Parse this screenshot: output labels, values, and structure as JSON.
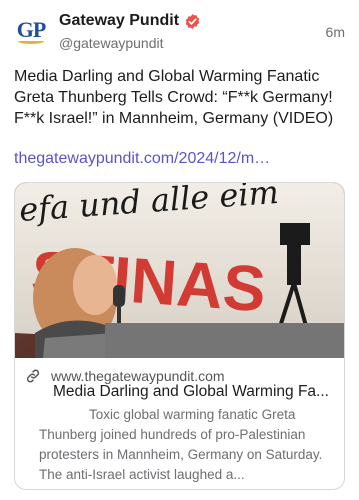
{
  "author": {
    "name": "Gateway Pundit",
    "handle": "@gatewaypundit",
    "avatar_text": "GP",
    "verified": true
  },
  "post": {
    "time": "6m",
    "text": "Media Darling and Global Warming Fanatic Greta Thunberg Tells Crowd: “F**k Germany! F**k Israel!” in Mannheim, Germany (VIDEO)",
    "link": "thegatewaypundit.com/2024/12/m…"
  },
  "card": {
    "domain": "www.thegatewaypundit.com",
    "title": "Media Darling and Global Warming Fa...",
    "description": "Toxic global warming fanatic Greta Thunberg joined hundreds of pro-Palestinian protesters in Mannheim, Germany on Saturday.  The anti-Israel activist laughed a...",
    "banner_text_top": "efa und alle eim",
    "banner_text_main": "STINAS"
  },
  "colors": {
    "link": "#5a54c9",
    "verified": "#e8534a",
    "brand_blue": "#1f4e9c",
    "brand_gold": "#e8b03a"
  },
  "icons": [
    "verified-badge-icon",
    "link-icon"
  ]
}
